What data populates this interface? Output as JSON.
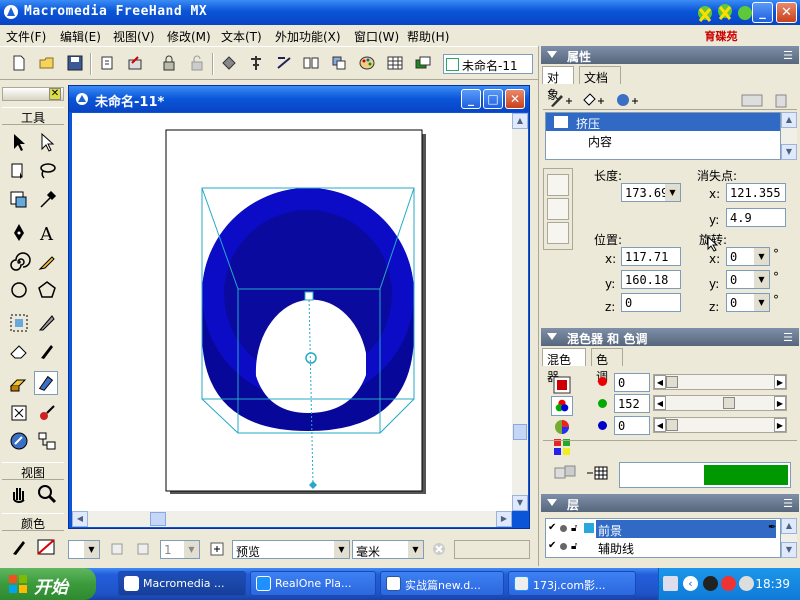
{
  "window": {
    "title": "Macromedia FreeHand MX",
    "logo_text": "育碟苑"
  },
  "menu": [
    "文件(F)",
    "编辑(E)",
    "视图(V)",
    "修改(M)",
    "文本(T)",
    "外加功能(X)",
    "窗口(W)",
    "帮助(H)"
  ],
  "toolbar": {
    "document_name": "未命名-11"
  },
  "tools_panel": {
    "tools_label": "工具",
    "view_label": "视图",
    "color_label": "颜色"
  },
  "document": {
    "title": "未命名-11*"
  },
  "status": {
    "page_value": "1",
    "view_mode": "预览",
    "units": "毫米"
  },
  "properties": {
    "title": "属性",
    "tabs": [
      "对象",
      "文档"
    ],
    "selected_tab": "对象",
    "object_list": [
      {
        "label": "挤压",
        "selected": true
      },
      {
        "label": "内容",
        "selected": false
      }
    ],
    "length_label": "长度:",
    "length_value": "173.69",
    "vanishing_label": "消失点:",
    "vp_x_label": "x:",
    "vp_x": "121.355",
    "vp_y_label": "y:",
    "vp_y": "4.9",
    "position_label": "位置:",
    "rotation_label": "旋转:",
    "pos_x_label": "x:",
    "pos_x": "117.71",
    "pos_y_label": "y:",
    "pos_y": "160.18",
    "pos_z_label": "z:",
    "pos_z": "0",
    "rot_x_label": "x:",
    "rot_x": "0",
    "rot_y_label": "y:",
    "rot_y": "0",
    "rot_z_label": "z:",
    "rot_z": "0",
    "degree": "°"
  },
  "mixer": {
    "title": "混色器 和 色调",
    "tabs": [
      "混色器",
      "色调"
    ],
    "selected_tab": "混色器",
    "red": "0",
    "green": "152",
    "blue": "0",
    "red_level": 0,
    "green_level": 0.596,
    "blue_level": 0,
    "swatch_color": "#009800"
  },
  "layers": {
    "title": "层",
    "items": [
      {
        "label": "前景",
        "selected": true
      },
      {
        "label": "辅助线",
        "selected": false
      }
    ]
  },
  "taskbar": {
    "start_label": "开始",
    "tasks": [
      "Macromedia ...",
      "RealOne Pla...",
      "实战篇new.d...",
      "173j.com影..."
    ],
    "active_task": 0,
    "clock": "18:39"
  },
  "colors": {
    "extrude_blue": "#0c0cc6",
    "accent_green": "#009800",
    "selection": "#316ac5"
  }
}
